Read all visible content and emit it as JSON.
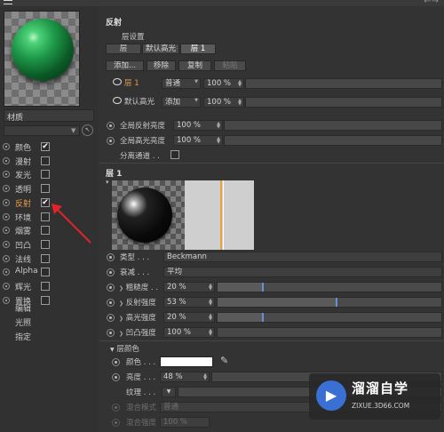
{
  "app": {
    "back_arrows": "←→"
  },
  "left_panel": {
    "material_name": "材质",
    "channels": [
      {
        "label": "颜色",
        "checked": true,
        "active": false
      },
      {
        "label": "漫射",
        "checked": false,
        "active": false
      },
      {
        "label": "发光",
        "checked": false,
        "active": false
      },
      {
        "label": "透明",
        "checked": false,
        "active": false
      },
      {
        "label": "反射",
        "checked": true,
        "active": true
      },
      {
        "label": "环境",
        "checked": false,
        "active": false
      },
      {
        "label": "烟雾",
        "checked": false,
        "active": false
      },
      {
        "label": "凹凸",
        "checked": false,
        "active": false
      },
      {
        "label": "法线",
        "checked": false,
        "active": false
      },
      {
        "label": "Alpha",
        "checked": false,
        "active": false
      },
      {
        "label": "辉光",
        "checked": false,
        "active": false
      },
      {
        "label": "置换",
        "checked": false,
        "active": false
      }
    ],
    "extra": [
      "编辑",
      "光照",
      "指定"
    ]
  },
  "right_panel": {
    "section_title": "反射",
    "layer_settings": "层设置",
    "tabs": [
      "层",
      "默认高光",
      "层 1"
    ],
    "buttons": [
      "添加...",
      "移除",
      "复制",
      "粘贴"
    ],
    "layers": [
      {
        "name": "层 1",
        "mode": "普通",
        "value": "100 %"
      },
      {
        "name": "默认高光",
        "mode": "添加",
        "value": "100 %"
      }
    ],
    "global": [
      {
        "label": "全局反射亮度",
        "value": "100 %"
      },
      {
        "label": "全局高光亮度",
        "value": "100 %"
      }
    ],
    "separate_pass": "分离通道 . .",
    "layer1_title": "层 1",
    "props": {
      "type_label": "类型 . . .",
      "type_value": "Beckmann",
      "atten_label": "衰减 . . .",
      "atten_value": "平均",
      "roughness_label": "粗糙度 . .",
      "roughness_value": "20 %",
      "roughness_level": 0.2,
      "reflect_label": "反射强度",
      "reflect_value": "53 %",
      "reflect_level": 0.53,
      "spec_label": "高光强度",
      "spec_value": "20 %",
      "spec_level": 0.2,
      "bump_label": "凹凸强度",
      "bump_value": "100 %"
    },
    "layer_color": {
      "title": "层颜色",
      "color_label": "颜色 . . .",
      "color_value": "#ffffff",
      "brightness_label": "亮度 . . .",
      "brightness_value": "48 %",
      "texture_label": "纹理 . . .",
      "blend_mode_label": "混合模式",
      "blend_mode_value": "普通",
      "blend_strength_label": "混合强度",
      "blend_strength_value": "100 %"
    }
  },
  "watermark": {
    "title": "溜溜自学",
    "url": "ZIXUE.3D66.COM"
  }
}
